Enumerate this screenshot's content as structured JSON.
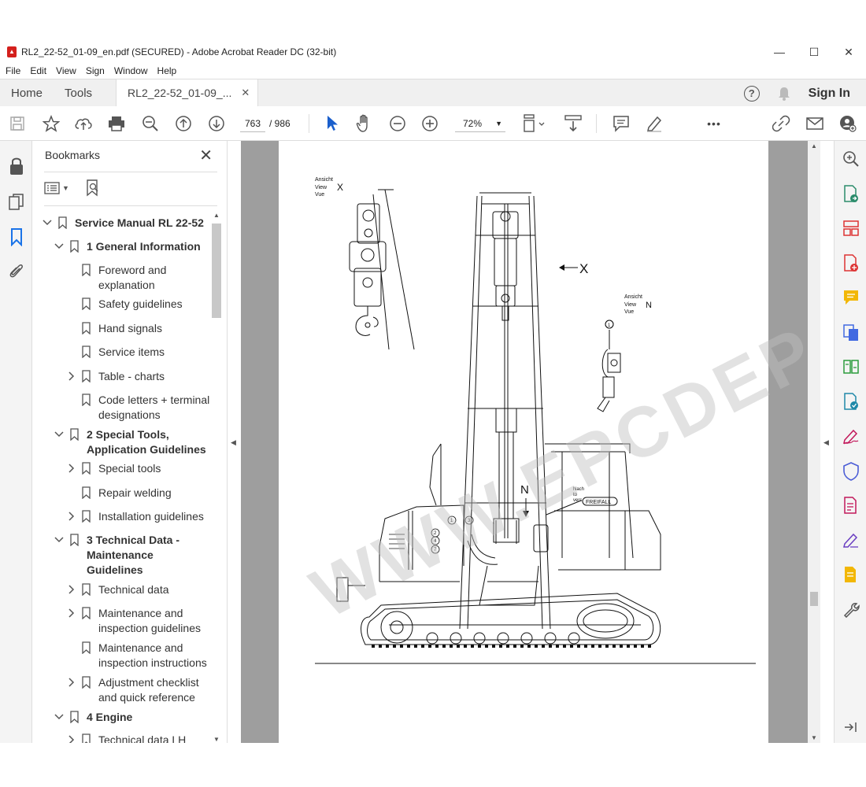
{
  "window": {
    "title": "RL2_22-52_01-09_en.pdf (SECURED) - Adobe Acrobat Reader DC (32-bit)",
    "controls": {
      "minimize": "—",
      "maximize": "☐",
      "close": "✕"
    }
  },
  "menu": [
    "File",
    "Edit",
    "View",
    "Sign",
    "Window",
    "Help"
  ],
  "tabs": {
    "home": "Home",
    "tools": "Tools",
    "document": "RL2_22-52_01-09_...",
    "close": "✕"
  },
  "header_right": {
    "help": "?",
    "signin": "Sign In"
  },
  "toolbar": {
    "page_current": "763",
    "page_total": "/ 986",
    "zoom": "72%",
    "more": "•••"
  },
  "bookmarks": {
    "title": "Bookmarks",
    "close": "✕",
    "items": [
      {
        "label": "Service Manual RL 22-52",
        "bold": true
      },
      {
        "label": "1 General Information",
        "bold": true
      },
      {
        "label": "Foreword and explanation"
      },
      {
        "label": "Safety guidelines"
      },
      {
        "label": "Hand signals"
      },
      {
        "label": "Service items"
      },
      {
        "label": "Table - charts"
      },
      {
        "label": "Code letters + terminal designations"
      },
      {
        "label": "2 Special Tools, Application Guidelines",
        "bold": true
      },
      {
        "label": "Special tools"
      },
      {
        "label": "Repair welding"
      },
      {
        "label": "Installation guidelines"
      },
      {
        "label": "3 Technical Data - Maintenance Guidelines",
        "bold": true
      },
      {
        "label": "Technical data"
      },
      {
        "label": "Maintenance and inspection guidelines"
      },
      {
        "label": "Maintenance and inspection instructions"
      },
      {
        "label": "Adjustment checklist and quick reference"
      },
      {
        "label": "4 Engine",
        "bold": true
      },
      {
        "label": "Technical data LH"
      }
    ]
  },
  "drawing": {
    "label_x_lines": [
      "Ansicht",
      "View",
      "Vue"
    ],
    "label_x": "X",
    "arrow_x": "X",
    "label_n_lines": [
      "Ansicht",
      "View",
      "Vue"
    ],
    "label_n": "N",
    "arrow_n": "N",
    "callout_lines": [
      "Nach",
      "to",
      "vers"
    ],
    "callout_box": "FREIFALL",
    "circle_marks": [
      "1",
      "1",
      "3",
      "2",
      "4",
      "7"
    ]
  },
  "watermark": "WWW.EPCDEPO.COM",
  "colors": {
    "accent_blue": "#1a73e8",
    "titlebar_bg": "#ffffff",
    "doc_bg": "#9e9e9e"
  }
}
